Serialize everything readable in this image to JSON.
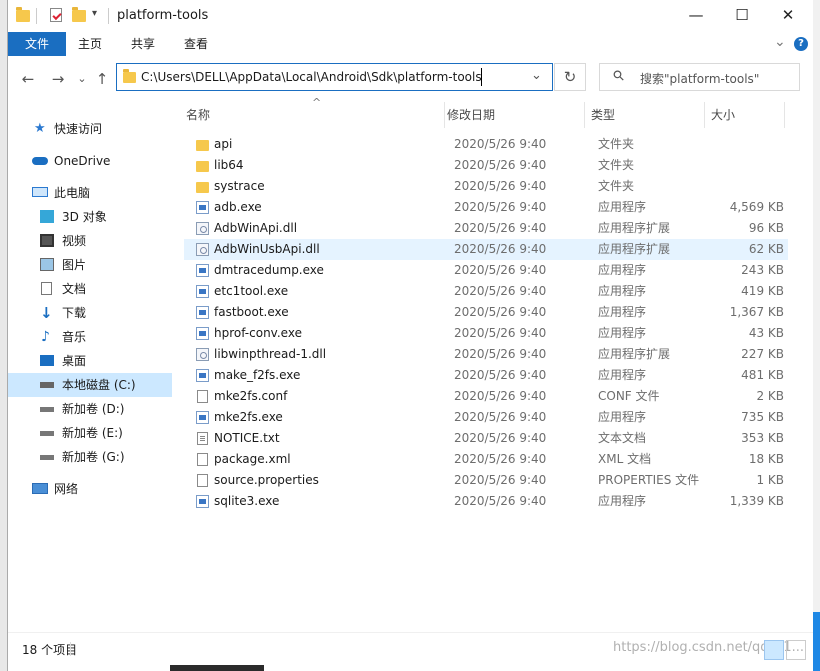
{
  "window": {
    "title": "platform-tools",
    "minimize": "—",
    "maximize": "☐",
    "close": "✕"
  },
  "ribbon": {
    "tabs": [
      "文件",
      "主页",
      "共享",
      "查看"
    ],
    "expand": "⌄",
    "help": "?"
  },
  "nav": {
    "back": "←",
    "forward": "→",
    "recent": "⌄",
    "up": "↑",
    "address": "C:\\Users\\DELL\\AppData\\Local\\Android\\Sdk\\platform-tools",
    "refresh": "↻",
    "dropdown": "⌄",
    "search_placeholder": "搜索\"platform-tools\"",
    "search_icon": "⚲"
  },
  "sidebar": {
    "items": [
      {
        "label": "快速访问",
        "icon": "star-icon",
        "indent": 1
      },
      {
        "label": "OneDrive",
        "icon": "cloud-icon",
        "indent": 1
      },
      {
        "label": "此电脑",
        "icon": "computer-icon",
        "indent": 1
      },
      {
        "label": "3D 对象",
        "icon": "cube-icon",
        "indent": 2
      },
      {
        "label": "视频",
        "icon": "film-icon",
        "indent": 2
      },
      {
        "label": "图片",
        "icon": "picture-icon",
        "indent": 2
      },
      {
        "label": "文档",
        "icon": "document-icon",
        "indent": 2
      },
      {
        "label": "下载",
        "icon": "download-icon",
        "indent": 2
      },
      {
        "label": "音乐",
        "icon": "music-icon",
        "indent": 2
      },
      {
        "label": "桌面",
        "icon": "desktop-icon",
        "indent": 2
      },
      {
        "label": "本地磁盘 (C:)",
        "icon": "drive-c-icon",
        "indent": 2
      },
      {
        "label": "新加卷 (D:)",
        "icon": "drive-icon",
        "indent": 2
      },
      {
        "label": "新加卷 (E:)",
        "icon": "drive-icon",
        "indent": 2
      },
      {
        "label": "新加卷 (G:)",
        "icon": "drive-icon",
        "indent": 2
      },
      {
        "label": "网络",
        "icon": "network-icon",
        "indent": 1
      }
    ],
    "selected": "本地磁盘 (C:)"
  },
  "columns": {
    "name": "名称",
    "date": "修改日期",
    "type": "类型",
    "size": "大小",
    "sort_indicator": "^"
  },
  "files": [
    {
      "name": "api",
      "date": "2020/5/26 9:40",
      "type": "文件夹",
      "size": "",
      "icon": "folder"
    },
    {
      "name": "lib64",
      "date": "2020/5/26 9:40",
      "type": "文件夹",
      "size": "",
      "icon": "folder"
    },
    {
      "name": "systrace",
      "date": "2020/5/26 9:40",
      "type": "文件夹",
      "size": "",
      "icon": "folder"
    },
    {
      "name": "adb.exe",
      "date": "2020/5/26 9:40",
      "type": "应用程序",
      "size": "4,569 KB",
      "icon": "exe"
    },
    {
      "name": "AdbWinApi.dll",
      "date": "2020/5/26 9:40",
      "type": "应用程序扩展",
      "size": "96 KB",
      "icon": "dll"
    },
    {
      "name": "AdbWinUsbApi.dll",
      "date": "2020/5/26 9:40",
      "type": "应用程序扩展",
      "size": "62 KB",
      "icon": "dll"
    },
    {
      "name": "dmtracedump.exe",
      "date": "2020/5/26 9:40",
      "type": "应用程序",
      "size": "243 KB",
      "icon": "exe"
    },
    {
      "name": "etc1tool.exe",
      "date": "2020/5/26 9:40",
      "type": "应用程序",
      "size": "419 KB",
      "icon": "exe"
    },
    {
      "name": "fastboot.exe",
      "date": "2020/5/26 9:40",
      "type": "应用程序",
      "size": "1,367 KB",
      "icon": "exe"
    },
    {
      "name": "hprof-conv.exe",
      "date": "2020/5/26 9:40",
      "type": "应用程序",
      "size": "43 KB",
      "icon": "exe"
    },
    {
      "name": "libwinpthread-1.dll",
      "date": "2020/5/26 9:40",
      "type": "应用程序扩展",
      "size": "227 KB",
      "icon": "dll"
    },
    {
      "name": "make_f2fs.exe",
      "date": "2020/5/26 9:40",
      "type": "应用程序",
      "size": "481 KB",
      "icon": "exe"
    },
    {
      "name": "mke2fs.conf",
      "date": "2020/5/26 9:40",
      "type": "CONF 文件",
      "size": "2 KB",
      "icon": "doc"
    },
    {
      "name": "mke2fs.exe",
      "date": "2020/5/26 9:40",
      "type": "应用程序",
      "size": "735 KB",
      "icon": "exe"
    },
    {
      "name": "NOTICE.txt",
      "date": "2020/5/26 9:40",
      "type": "文本文档",
      "size": "353 KB",
      "icon": "txt"
    },
    {
      "name": "package.xml",
      "date": "2020/5/26 9:40",
      "type": "XML 文档",
      "size": "18 KB",
      "icon": "doc"
    },
    {
      "name": "source.properties",
      "date": "2020/5/26 9:40",
      "type": "PROPERTIES 文件",
      "size": "1 KB",
      "icon": "doc"
    },
    {
      "name": "sqlite3.exe",
      "date": "2020/5/26 9:40",
      "type": "应用程序",
      "size": "1,339 KB",
      "icon": "exe"
    }
  ],
  "hovered_file": "AdbWinUsbApi.dll",
  "status": {
    "count": "18 个项目",
    "watermark": "https://blog.csdn.net/qq_41..."
  }
}
